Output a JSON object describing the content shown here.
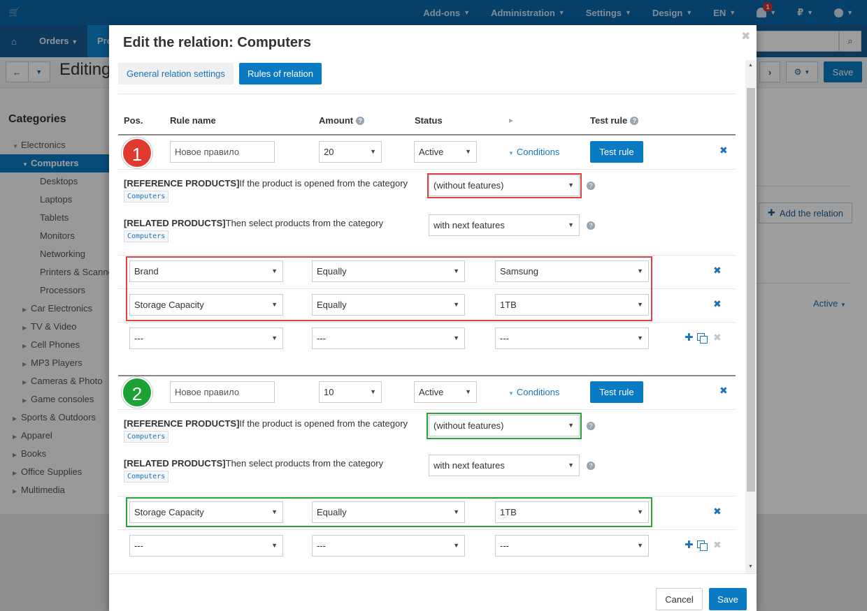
{
  "topbar": {
    "items": [
      {
        "label": "Add-ons"
      },
      {
        "label": "Administration"
      },
      {
        "label": "Settings"
      },
      {
        "label": "Design"
      },
      {
        "label": "EN"
      }
    ],
    "notifications_count": "1",
    "currency": "₽"
  },
  "secnav": {
    "orders": "Orders",
    "products_partial": "Pro"
  },
  "toolbar": {
    "title_partial": "Editing",
    "save": "Save"
  },
  "categories": {
    "title": "Categories",
    "items": [
      {
        "label": "Electronics",
        "level": 0,
        "arrow": "▼"
      },
      {
        "label": "Computers",
        "level": 1,
        "arrow": "▼",
        "active": true
      },
      {
        "label": "Desktops",
        "level": 2
      },
      {
        "label": "Laptops",
        "level": 2
      },
      {
        "label": "Tablets",
        "level": 2
      },
      {
        "label": "Monitors",
        "level": 2
      },
      {
        "label": "Networking",
        "level": 2
      },
      {
        "label": "Printers & Scanners",
        "level": 2
      },
      {
        "label": "Processors",
        "level": 2
      },
      {
        "label": "Car Electronics",
        "level": 1,
        "arrow": "▶"
      },
      {
        "label": "TV & Video",
        "level": 1,
        "arrow": "▶"
      },
      {
        "label": "Cell Phones",
        "level": 1,
        "arrow": "▶"
      },
      {
        "label": "MP3 Players",
        "level": 1,
        "arrow": "▶"
      },
      {
        "label": "Cameras & Photo",
        "level": 1,
        "arrow": "▶"
      },
      {
        "label": "Game consoles",
        "level": 1,
        "arrow": "▶"
      },
      {
        "label": "Sports & Outdoors",
        "level": 0,
        "arrow": "▶"
      },
      {
        "label": "Apparel",
        "level": 0,
        "arrow": "▶"
      },
      {
        "label": "Books",
        "level": 0,
        "arrow": "▶"
      },
      {
        "label": "Office Supplies",
        "level": 0,
        "arrow": "▶"
      },
      {
        "label": "Multimedia",
        "level": 0,
        "arrow": "▶"
      }
    ]
  },
  "background": {
    "add_relation": "Add the relation",
    "status_active": "Active"
  },
  "modal": {
    "title": "Edit the relation: Computers",
    "tabs": {
      "general": "General relation settings",
      "rules": "Rules of relation"
    },
    "headers": {
      "pos": "Pos.",
      "rule_name": "Rule name",
      "amount": "Amount",
      "status": "Status",
      "test_rule": "Test rule"
    },
    "conditions_label": "Conditions",
    "test_rule_button": "Test rule",
    "reference_prefix": "[REFERENCE PRODUCTS]",
    "reference_text": "If the product is opened from the category",
    "related_prefix": "[RELATED PRODUCTS]",
    "related_text": "Then select products from the category",
    "category_tag": "Computers",
    "rules": [
      {
        "pos": "1",
        "name": "Новое правило",
        "amount": "20",
        "status": "Active",
        "reference_mode": "(without features)",
        "related_mode": "with next features",
        "conditions": [
          {
            "feature": "Brand",
            "operator": "Equally",
            "value": "Samsung"
          },
          {
            "feature": "Storage Capacity",
            "operator": "Equally",
            "value": "1TB"
          },
          {
            "feature": "---",
            "operator": "---",
            "value": "---"
          }
        ]
      },
      {
        "pos": "2",
        "name": "Новое правило",
        "amount": "10",
        "status": "Active",
        "reference_mode": "(without features)",
        "related_mode": "with next features",
        "conditions": [
          {
            "feature": "Storage Capacity",
            "operator": "Equally",
            "value": "1TB"
          },
          {
            "feature": "---",
            "operator": "---",
            "value": "---"
          }
        ]
      }
    ],
    "footer": {
      "cancel": "Cancel",
      "save": "Save"
    }
  }
}
